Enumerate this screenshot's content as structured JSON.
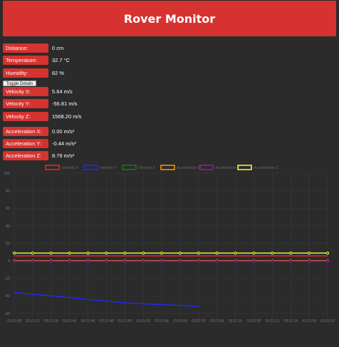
{
  "header": {
    "title": "Rover Monitor"
  },
  "readings": [
    {
      "label": "Distance:",
      "value": "0 cm"
    },
    {
      "label": "Temperature:",
      "value": "32.7 °C"
    },
    {
      "label": "Humidity:",
      "value": "62 %"
    }
  ],
  "toggle_label": "Toggle Details",
  "velocity": [
    {
      "label": "Velocity X:",
      "value": "5.64 m/s"
    },
    {
      "label": "Velocity Y:",
      "value": "-56.81 m/s"
    },
    {
      "label": "Velocity Z:",
      "value": "1568.20 m/s"
    }
  ],
  "acceleration": [
    {
      "label": "Acceleration X:",
      "value": "0.00 m/s²"
    },
    {
      "label": "Acceleration Y:",
      "value": "-0.44 m/s²"
    },
    {
      "label": "Acceleration Z:",
      "value": "8.79 m/s²"
    }
  ],
  "colors": {
    "accent": "#d63330",
    "background": "#2b2b2b",
    "grid": "#3a3a3a"
  },
  "chart_data": {
    "type": "line",
    "ylim": [
      -65,
      100
    ],
    "yticks": [
      100,
      80,
      60,
      40,
      20,
      0,
      -20,
      -40,
      -60
    ],
    "x": [
      "03:21:08",
      "03:21:32",
      "03:21:36",
      "03:21:40",
      "03:21:44",
      "03:21:48",
      "03:21:50",
      "03:21:52",
      "03:21:56",
      "03:22:00",
      "03:22:03",
      "03:22:06",
      "03:22:10",
      "03:22:09",
      "03:22:13",
      "03:22:14",
      "03:22:18",
      "03:22:19"
    ],
    "series": [
      {
        "name": "Velocity X",
        "color": "#ff2020",
        "values": [
          5.6,
          5.6,
          5.6,
          5.6,
          5.6,
          5.6,
          5.6,
          5.6,
          5.6,
          5.6,
          5.6,
          5.6,
          5.6,
          5.6,
          5.6,
          5.6,
          5.6,
          5.6
        ]
      },
      {
        "name": "Velocity Y",
        "color": "#1f2bff",
        "values": [
          -36,
          -38,
          -40,
          -42,
          -44,
          -46,
          -48,
          -49,
          -50,
          -51,
          -52,
          null,
          null,
          null,
          null,
          null,
          null,
          null
        ]
      },
      {
        "name": "Velocity Z",
        "color": "#1a7a1a",
        "values": []
      },
      {
        "name": "Acceleration X",
        "color": "#ff9900",
        "values": [
          0,
          0,
          0,
          0,
          0,
          0,
          0,
          0,
          0,
          0,
          0,
          0,
          0,
          0,
          0,
          0,
          0,
          0
        ]
      },
      {
        "name": "Acceleration Y",
        "color": "#9a1a9a",
        "values": [
          -0.4,
          -0.4,
          -0.4,
          -0.4,
          -0.4,
          -0.4,
          -0.4,
          -0.4,
          -0.4,
          -0.4,
          -0.4,
          -0.4,
          -0.4,
          -0.4,
          -0.4,
          -0.4,
          -0.4,
          -0.4
        ]
      },
      {
        "name": "Acceleration Z",
        "color": "#ffff33",
        "values": [
          8.8,
          8.8,
          8.8,
          8.8,
          8.8,
          8.8,
          8.8,
          8.8,
          8.8,
          8.8,
          8.8,
          8.8,
          8.8,
          8.8,
          8.8,
          8.8,
          8.8,
          8.8
        ]
      }
    ]
  }
}
